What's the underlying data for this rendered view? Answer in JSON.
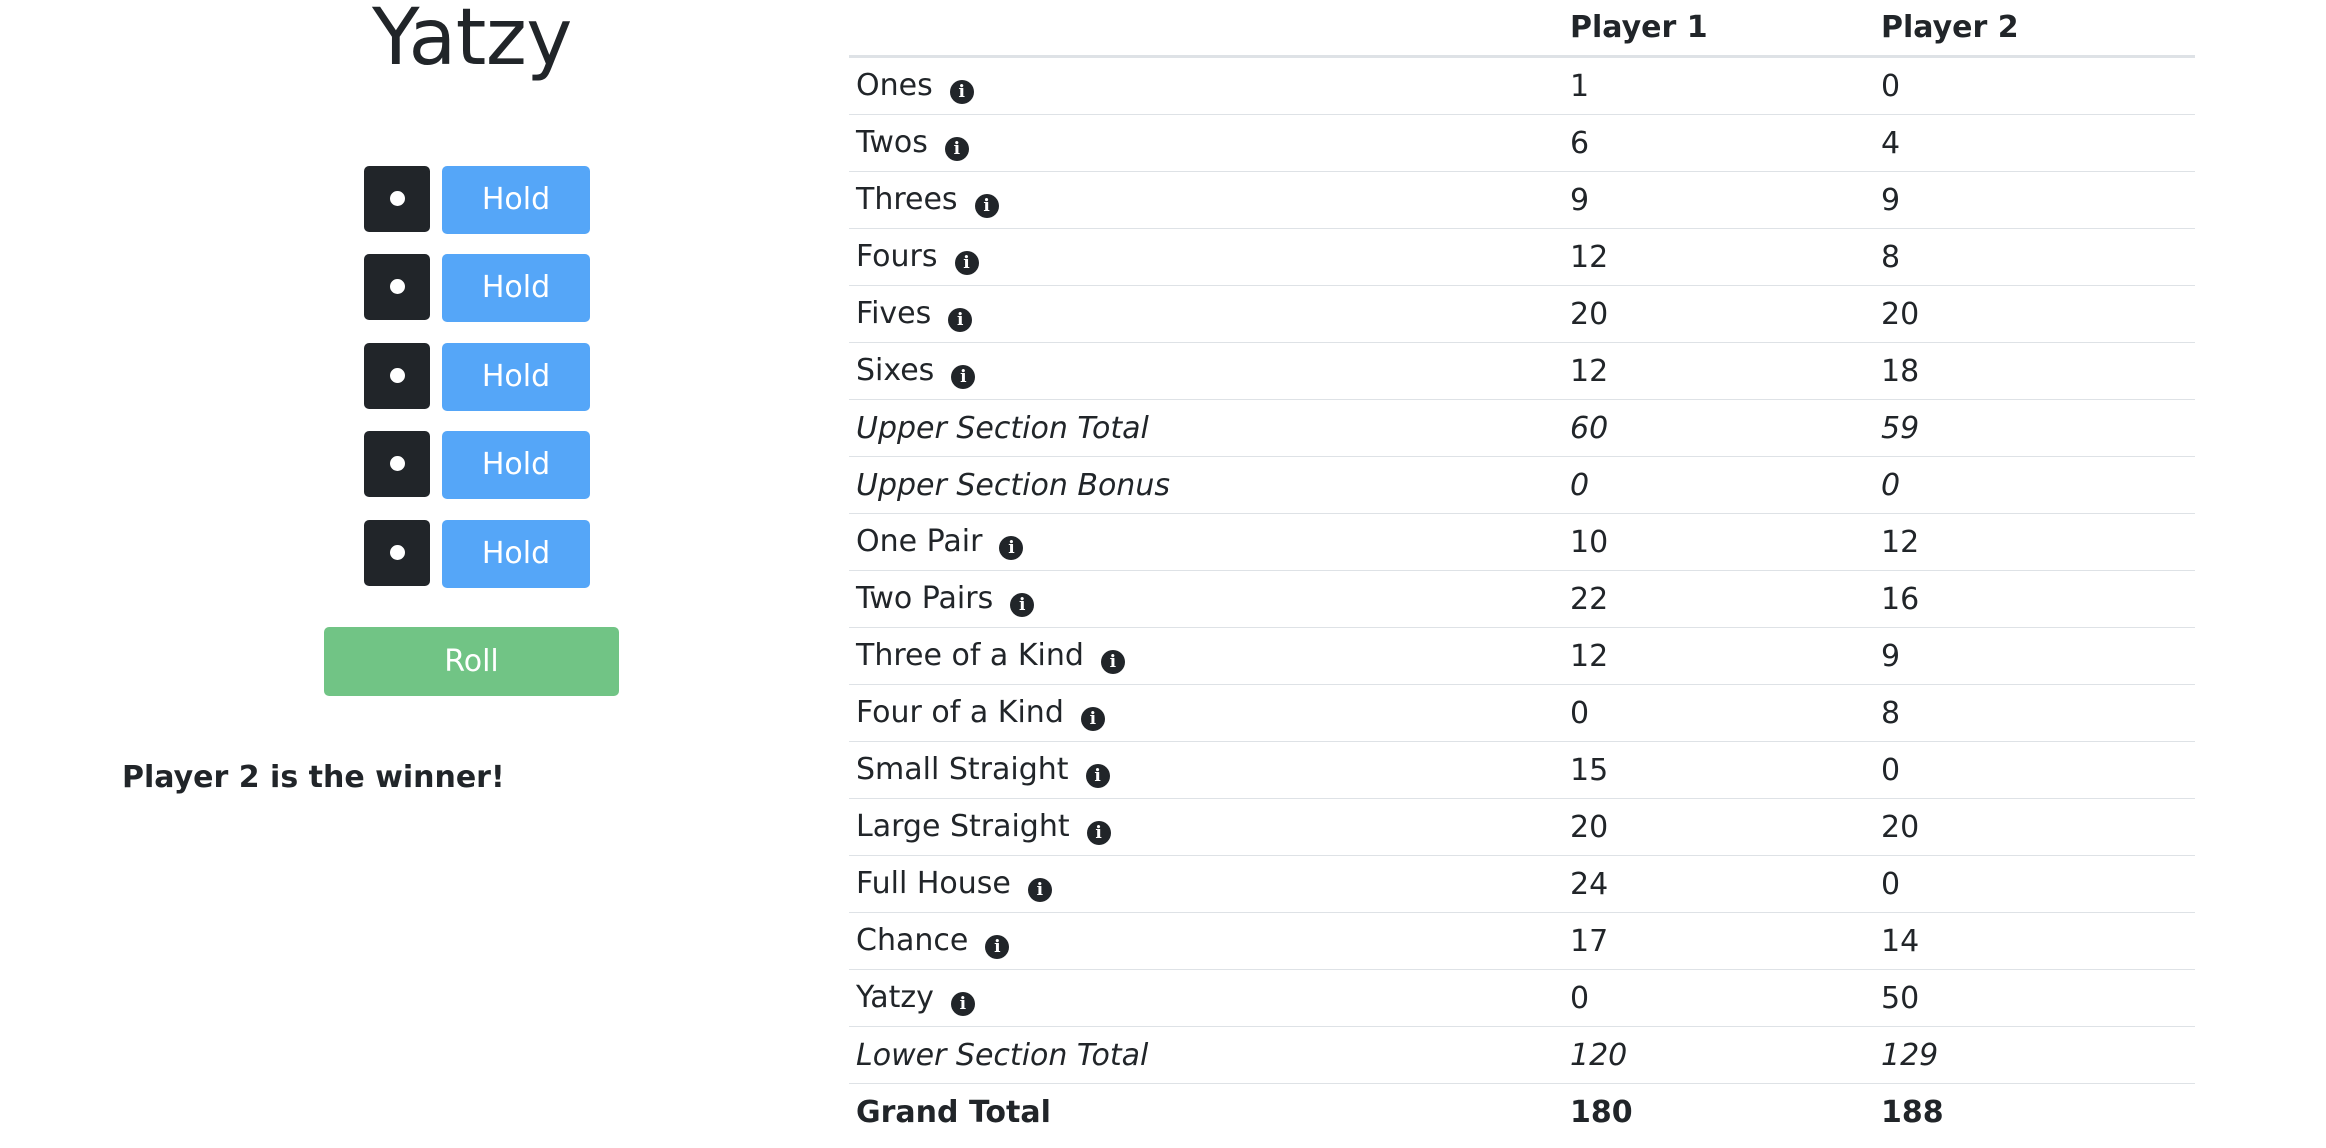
{
  "title": "Yatzy",
  "dice": [
    {
      "value": 1,
      "hold_label": "Hold"
    },
    {
      "value": 1,
      "hold_label": "Hold"
    },
    {
      "value": 1,
      "hold_label": "Hold"
    },
    {
      "value": 1,
      "hold_label": "Hold"
    },
    {
      "value": 1,
      "hold_label": "Hold"
    }
  ],
  "roll_label": "Roll",
  "winner_text": "Player 2 is the winner!",
  "scorecard": {
    "headers": [
      "",
      "Player 1",
      "Player 2"
    ],
    "info_icon": "info-circle-icon",
    "rows": [
      {
        "label": "Ones",
        "p1": "1",
        "p2": "0"
      },
      {
        "label": "Twos",
        "p1": "6",
        "p2": "4"
      },
      {
        "label": "Threes",
        "p1": "9",
        "p2": "9"
      },
      {
        "label": "Fours",
        "p1": "12",
        "p2": "8"
      },
      {
        "label": "Fives",
        "p1": "20",
        "p2": "20"
      },
      {
        "label": "Sixes",
        "p1": "12",
        "p2": "18"
      },
      {
        "label": "Upper Section Total",
        "p1": "60",
        "p2": "59"
      },
      {
        "label": "Upper Section Bonus",
        "p1": "0",
        "p2": "0"
      },
      {
        "label": "One Pair",
        "p1": "10",
        "p2": "12"
      },
      {
        "label": "Two Pairs",
        "p1": "22",
        "p2": "16"
      },
      {
        "label": "Three of a Kind",
        "p1": "12",
        "p2": "9"
      },
      {
        "label": "Four of a Kind",
        "p1": "0",
        "p2": "8"
      },
      {
        "label": "Small Straight",
        "p1": "15",
        "p2": "0"
      },
      {
        "label": "Large Straight",
        "p1": "20",
        "p2": "20"
      },
      {
        "label": "Full House",
        "p1": "24",
        "p2": "0"
      },
      {
        "label": "Chance",
        "p1": "17",
        "p2": "14"
      },
      {
        "label": "Yatzy",
        "p1": "0",
        "p2": "50"
      },
      {
        "label": "Lower Section Total",
        "p1": "120",
        "p2": "129"
      },
      {
        "label": "Grand Total",
        "p1": "180",
        "p2": "188"
      }
    ]
  },
  "colors": {
    "die": "#212529",
    "hold_button": "#55a6f8",
    "roll_button": "#71c485",
    "text": "#212529"
  }
}
